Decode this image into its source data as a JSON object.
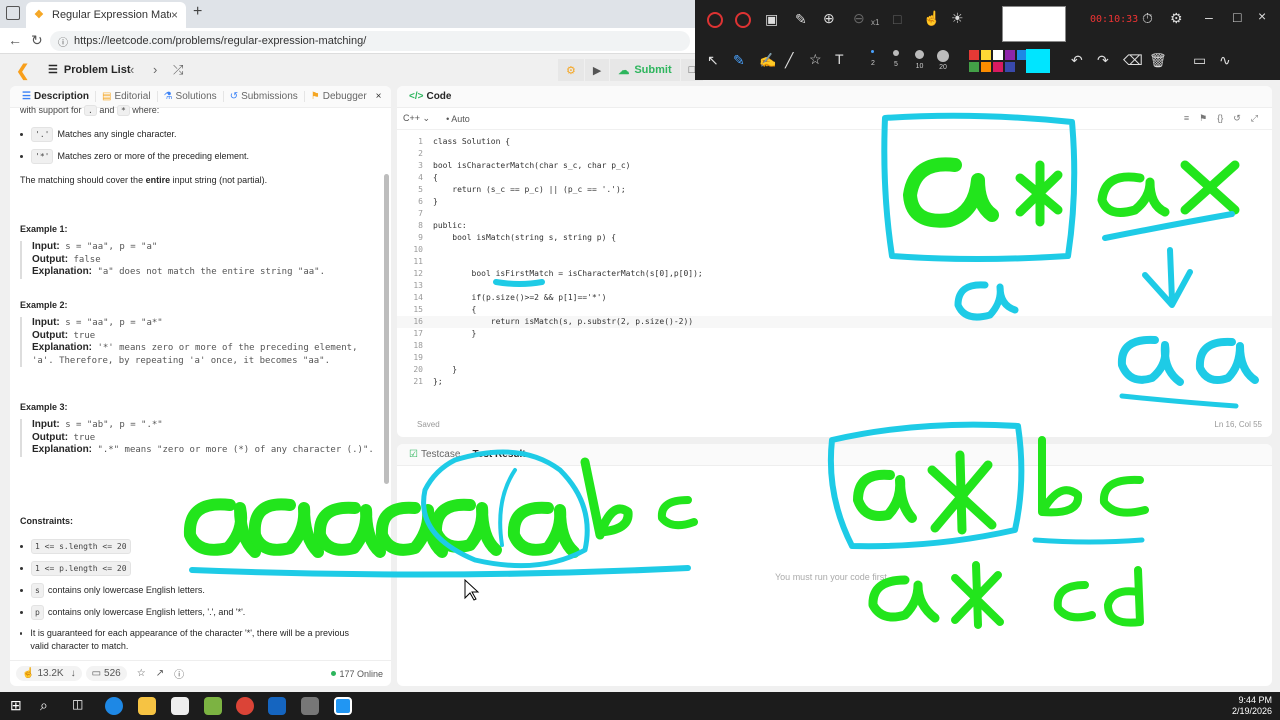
{
  "browser": {
    "tab_title": "Regular Expression Matching - Lee",
    "url": "https://leetcode.com/problems/regular-expression-matching/"
  },
  "header": {
    "problem_list": "Problem List",
    "submit": "Submit"
  },
  "desc_tabs": [
    "Description",
    "Editorial",
    "Solutions",
    "Submissions",
    "Debugger"
  ],
  "description": {
    "top_cut": "with support for",
    "top_chip1": ".",
    "top_and": "and",
    "top_chip2": "*",
    "top_where": "where:",
    "rule1_chip": "'.'",
    "rule1": "Matches any single character.",
    "rule2_chip": "'*'",
    "rule2": "Matches zero or more of the preceding element.",
    "cover_pre": "The matching should cover the",
    "cover_bold": "entire",
    "cover_post": "input string (not partial).",
    "examples": [
      {
        "title": "Example 1:",
        "input": "s = \"aa\", p = \"a\"",
        "output": "false",
        "explanation": "\"a\" does not match the entire string \"aa\"."
      },
      {
        "title": "Example 2:",
        "input": "s = \"aa\", p = \"a*\"",
        "output": "true",
        "explanation": "'*' means zero or more of the preceding element, 'a'. Therefore, by repeating 'a' once, it becomes \"aa\"."
      },
      {
        "title": "Example 3:",
        "input": "s = \"ab\", p = \".*\"",
        "output": "true",
        "explanation": "\".*\" means \"zero or more (*) of any character (.)\"."
      }
    ],
    "labels": {
      "input": "Input:",
      "output": "Output:",
      "explanation": "Explanation:"
    },
    "constraints_title": "Constraints:",
    "constraints": [
      {
        "chip": "1 <= s.length <= 20",
        "text": ""
      },
      {
        "chip": "1 <= p.length <= 20",
        "text": ""
      },
      {
        "chip": "s",
        "text": "contains only lowercase English letters."
      },
      {
        "chip": "p",
        "text": "contains only lowercase English letters, '.', and '*'."
      }
    ],
    "guarantee": "It is guaranteed for each appearance of the character '*', there will be a previous valid character to match."
  },
  "footer": {
    "likes": "13.2K",
    "comments": "526",
    "online": "177 Online"
  },
  "code": {
    "title": "Code",
    "lang": "C++",
    "mode": "Auto",
    "lines": [
      "class Solution {",
      "",
      "bool isCharacterMatch(char s_c, char p_c)",
      "{",
      "    return (s_c == p_c) || (p_c == '.');",
      "}",
      "",
      "public:",
      "    bool isMatch(string s, string p) {",
      "",
      "",
      "        bool isFirstMatch = isCharacterMatch(s[0],p[0]);",
      "",
      "        if(p.size()>=2 && p[1]=='*')",
      "        {",
      "            return isMatch(s, p.substr(2, p.size()-2))",
      "        }",
      "",
      "",
      "    }",
      "};"
    ],
    "saved": "Saved",
    "cursor": "Ln 16, Col 55"
  },
  "test": {
    "tab1": "Testcase",
    "tab2": "Test Result",
    "message": "You must run your code first"
  },
  "annot_toolbar": {
    "timer": "00:10:33",
    "zoom": "x1",
    "sizes": [
      "2",
      "5",
      "10",
      "20"
    ],
    "colors": [
      "#e53935",
      "#fdd835",
      "#ffffff",
      "#8e24aa",
      "#1e88e5",
      "#43a047",
      "#fb8c00",
      "#d81b60",
      "#3949ab",
      "#00e5ff"
    ]
  },
  "taskbar": {
    "time": "9:44 PM",
    "date": "2/19/2026"
  },
  "colors": {
    "cyan_ink": "#1ecbe6",
    "green_ink": "#22e51c",
    "accent": "#2db55d"
  }
}
